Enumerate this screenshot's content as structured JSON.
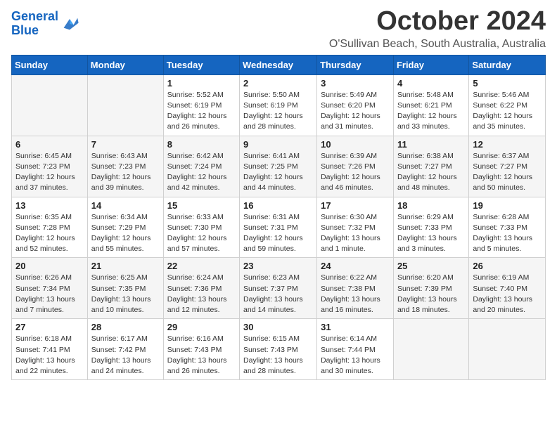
{
  "header": {
    "logo_line1": "General",
    "logo_line2": "Blue",
    "month": "October 2024",
    "location": "O'Sullivan Beach, South Australia, Australia"
  },
  "weekdays": [
    "Sunday",
    "Monday",
    "Tuesday",
    "Wednesday",
    "Thursday",
    "Friday",
    "Saturday"
  ],
  "weeks": [
    [
      {
        "day": "",
        "info": ""
      },
      {
        "day": "",
        "info": ""
      },
      {
        "day": "1",
        "info": "Sunrise: 5:52 AM\nSunset: 6:19 PM\nDaylight: 12 hours\nand 26 minutes."
      },
      {
        "day": "2",
        "info": "Sunrise: 5:50 AM\nSunset: 6:19 PM\nDaylight: 12 hours\nand 28 minutes."
      },
      {
        "day": "3",
        "info": "Sunrise: 5:49 AM\nSunset: 6:20 PM\nDaylight: 12 hours\nand 31 minutes."
      },
      {
        "day": "4",
        "info": "Sunrise: 5:48 AM\nSunset: 6:21 PM\nDaylight: 12 hours\nand 33 minutes."
      },
      {
        "day": "5",
        "info": "Sunrise: 5:46 AM\nSunset: 6:22 PM\nDaylight: 12 hours\nand 35 minutes."
      }
    ],
    [
      {
        "day": "6",
        "info": "Sunrise: 6:45 AM\nSunset: 7:23 PM\nDaylight: 12 hours\nand 37 minutes."
      },
      {
        "day": "7",
        "info": "Sunrise: 6:43 AM\nSunset: 7:23 PM\nDaylight: 12 hours\nand 39 minutes."
      },
      {
        "day": "8",
        "info": "Sunrise: 6:42 AM\nSunset: 7:24 PM\nDaylight: 12 hours\nand 42 minutes."
      },
      {
        "day": "9",
        "info": "Sunrise: 6:41 AM\nSunset: 7:25 PM\nDaylight: 12 hours\nand 44 minutes."
      },
      {
        "day": "10",
        "info": "Sunrise: 6:39 AM\nSunset: 7:26 PM\nDaylight: 12 hours\nand 46 minutes."
      },
      {
        "day": "11",
        "info": "Sunrise: 6:38 AM\nSunset: 7:27 PM\nDaylight: 12 hours\nand 48 minutes."
      },
      {
        "day": "12",
        "info": "Sunrise: 6:37 AM\nSunset: 7:27 PM\nDaylight: 12 hours\nand 50 minutes."
      }
    ],
    [
      {
        "day": "13",
        "info": "Sunrise: 6:35 AM\nSunset: 7:28 PM\nDaylight: 12 hours\nand 52 minutes."
      },
      {
        "day": "14",
        "info": "Sunrise: 6:34 AM\nSunset: 7:29 PM\nDaylight: 12 hours\nand 55 minutes."
      },
      {
        "day": "15",
        "info": "Sunrise: 6:33 AM\nSunset: 7:30 PM\nDaylight: 12 hours\nand 57 minutes."
      },
      {
        "day": "16",
        "info": "Sunrise: 6:31 AM\nSunset: 7:31 PM\nDaylight: 12 hours\nand 59 minutes."
      },
      {
        "day": "17",
        "info": "Sunrise: 6:30 AM\nSunset: 7:32 PM\nDaylight: 13 hours\nand 1 minute."
      },
      {
        "day": "18",
        "info": "Sunrise: 6:29 AM\nSunset: 7:33 PM\nDaylight: 13 hours\nand 3 minutes."
      },
      {
        "day": "19",
        "info": "Sunrise: 6:28 AM\nSunset: 7:33 PM\nDaylight: 13 hours\nand 5 minutes."
      }
    ],
    [
      {
        "day": "20",
        "info": "Sunrise: 6:26 AM\nSunset: 7:34 PM\nDaylight: 13 hours\nand 7 minutes."
      },
      {
        "day": "21",
        "info": "Sunrise: 6:25 AM\nSunset: 7:35 PM\nDaylight: 13 hours\nand 10 minutes."
      },
      {
        "day": "22",
        "info": "Sunrise: 6:24 AM\nSunset: 7:36 PM\nDaylight: 13 hours\nand 12 minutes."
      },
      {
        "day": "23",
        "info": "Sunrise: 6:23 AM\nSunset: 7:37 PM\nDaylight: 13 hours\nand 14 minutes."
      },
      {
        "day": "24",
        "info": "Sunrise: 6:22 AM\nSunset: 7:38 PM\nDaylight: 13 hours\nand 16 minutes."
      },
      {
        "day": "25",
        "info": "Sunrise: 6:20 AM\nSunset: 7:39 PM\nDaylight: 13 hours\nand 18 minutes."
      },
      {
        "day": "26",
        "info": "Sunrise: 6:19 AM\nSunset: 7:40 PM\nDaylight: 13 hours\nand 20 minutes."
      }
    ],
    [
      {
        "day": "27",
        "info": "Sunrise: 6:18 AM\nSunset: 7:41 PM\nDaylight: 13 hours\nand 22 minutes."
      },
      {
        "day": "28",
        "info": "Sunrise: 6:17 AM\nSunset: 7:42 PM\nDaylight: 13 hours\nand 24 minutes."
      },
      {
        "day": "29",
        "info": "Sunrise: 6:16 AM\nSunset: 7:43 PM\nDaylight: 13 hours\nand 26 minutes."
      },
      {
        "day": "30",
        "info": "Sunrise: 6:15 AM\nSunset: 7:43 PM\nDaylight: 13 hours\nand 28 minutes."
      },
      {
        "day": "31",
        "info": "Sunrise: 6:14 AM\nSunset: 7:44 PM\nDaylight: 13 hours\nand 30 minutes."
      },
      {
        "day": "",
        "info": ""
      },
      {
        "day": "",
        "info": ""
      }
    ]
  ]
}
